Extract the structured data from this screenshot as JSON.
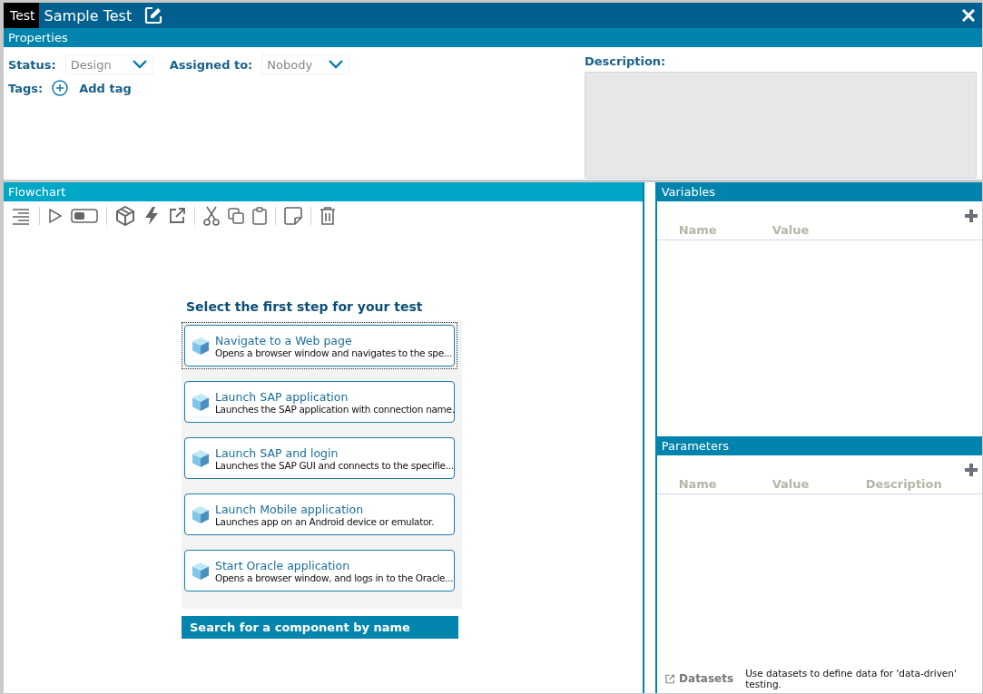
{
  "window": {
    "tab": "Test",
    "title": "Sample Test"
  },
  "properties": {
    "header": "Properties",
    "status_label": "Status:",
    "status_value": "Design",
    "assigned_label": "Assigned to:",
    "assigned_value": "Nobody",
    "tags_label": "Tags:",
    "add_tag": "Add tag",
    "description_label": "Description:"
  },
  "flowchart": {
    "header": "Flowchart",
    "prompt": "Select the first step for your test",
    "steps": [
      {
        "title": "Navigate to a Web page",
        "description": "Opens a browser window and navigates to the spe...",
        "selected": true
      },
      {
        "title": "Launch SAP application",
        "description": "Launches the SAP application with connection name.",
        "selected": false
      },
      {
        "title": "Launch SAP and login",
        "description": "Launches the SAP GUI and connects to the specifie...",
        "selected": false
      },
      {
        "title": "Launch Mobile application",
        "description": "Launches app on an Android device or emulator.",
        "selected": false
      },
      {
        "title": "Start Oracle application",
        "description": "Opens a browser window, and logs in to the Oracle...",
        "selected": false
      }
    ],
    "search_placeholder": "Search for a component by name"
  },
  "variables": {
    "header": "Variables",
    "columns": [
      "Name",
      "Value"
    ]
  },
  "parameters": {
    "header": "Parameters",
    "columns": [
      "Name",
      "Value",
      "Description"
    ]
  },
  "datasets": {
    "link": "Datasets",
    "hint": "Use datasets to define data for 'data-driven' testing."
  }
}
